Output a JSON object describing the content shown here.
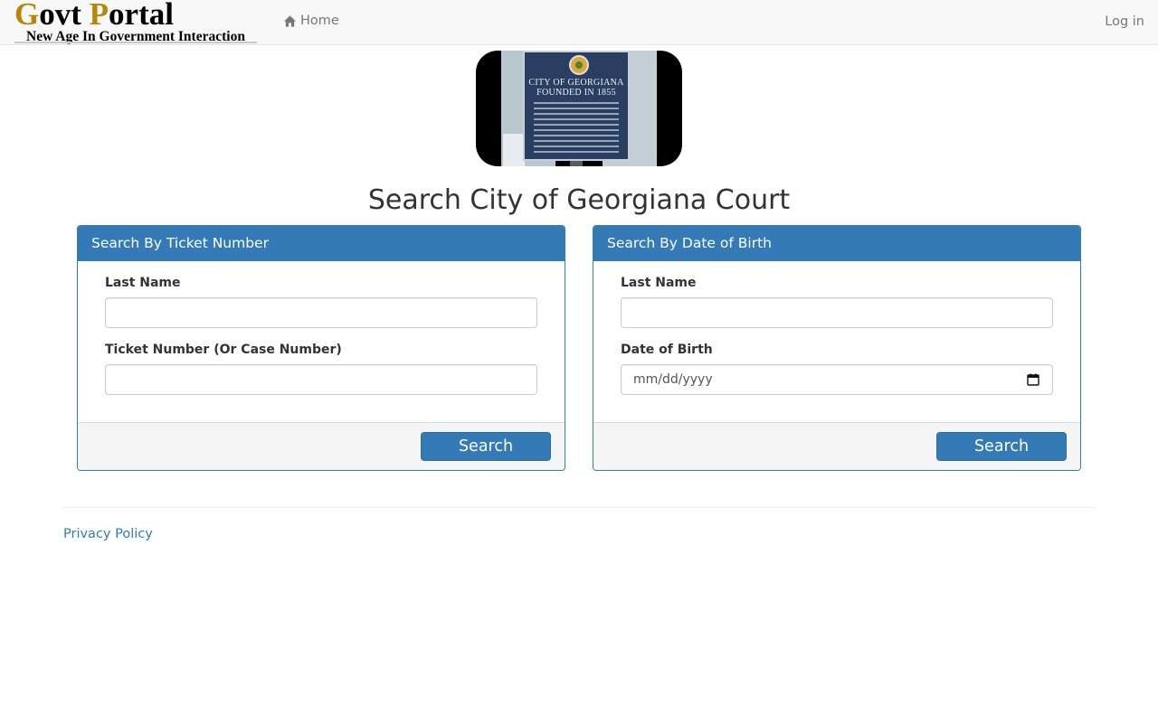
{
  "navbar": {
    "logo": {
      "title_cap1": "G",
      "title_rest1": "ovt ",
      "title_cap2": "P",
      "title_rest2": "ortal",
      "subtitle": "New Age In Government Interaction"
    },
    "home_label": "Home",
    "home_icon": "home-icon",
    "login_label": "Log in"
  },
  "hero": {
    "sign_line1": "CITY OF GEORGIANA",
    "sign_line2": "FOUNDED IN 1855"
  },
  "page_title": "Search City of Georgiana Court",
  "panels": [
    {
      "heading": "Search By Ticket Number",
      "fields": [
        {
          "label": "Last Name",
          "value": ""
        },
        {
          "label": "Ticket Number (Or Case Number)",
          "value": ""
        }
      ],
      "button_label": "Search"
    },
    {
      "heading": "Search By Date of Birth",
      "fields": [
        {
          "label": "Last Name",
          "value": ""
        },
        {
          "label": "Date of Birth",
          "placeholder": "mm/dd/yyyy",
          "icon": "calendar-icon"
        }
      ],
      "button_label": "Search"
    }
  ],
  "footer": {
    "privacy_label": "Privacy Policy"
  },
  "colors": {
    "primary": "#337ab7",
    "logo_accent": "#b8860b",
    "navbar_bg": "#f8f8f8",
    "nav_text": "#777777"
  }
}
